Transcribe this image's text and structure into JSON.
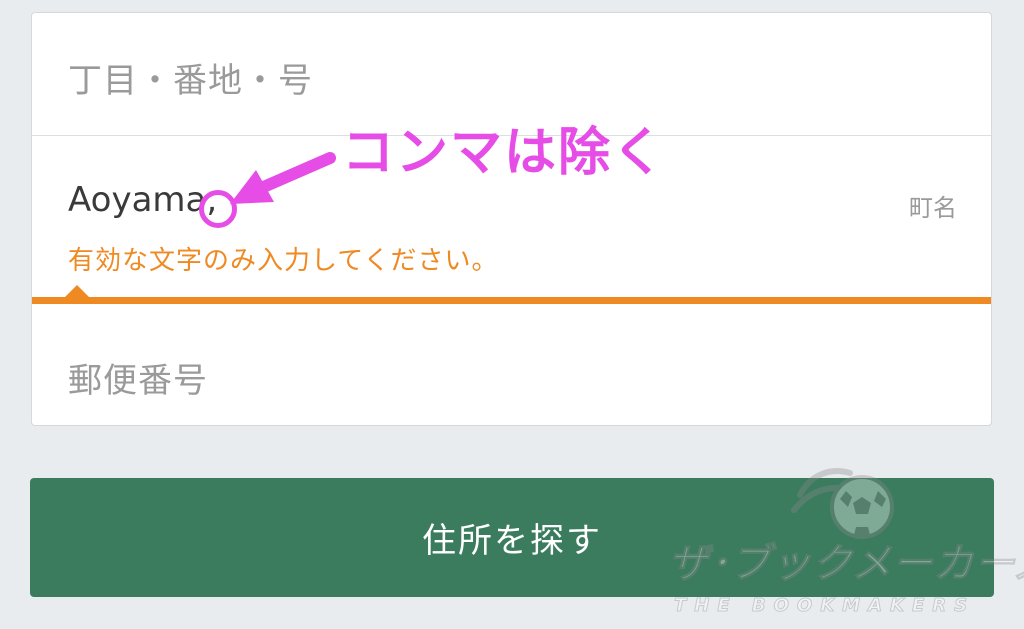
{
  "form": {
    "chome_placeholder": "丁目・番地・号",
    "town_value": "Aoyama,",
    "town_tag": "町名",
    "town_error": "有効な文字のみ入力してください。",
    "postal_placeholder": "郵便番号"
  },
  "search_button": {
    "label": "住所を探す"
  },
  "annotation": {
    "text": "コンマは除く",
    "color": "#e64ce6"
  },
  "watermark": {
    "title": "ザ･ブックメーカーズ”",
    "subtitle": "THE BOOKMAKERS"
  },
  "colors": {
    "error": "#ef8a23",
    "button": "#3b7c5e",
    "background": "#e9ecef"
  }
}
